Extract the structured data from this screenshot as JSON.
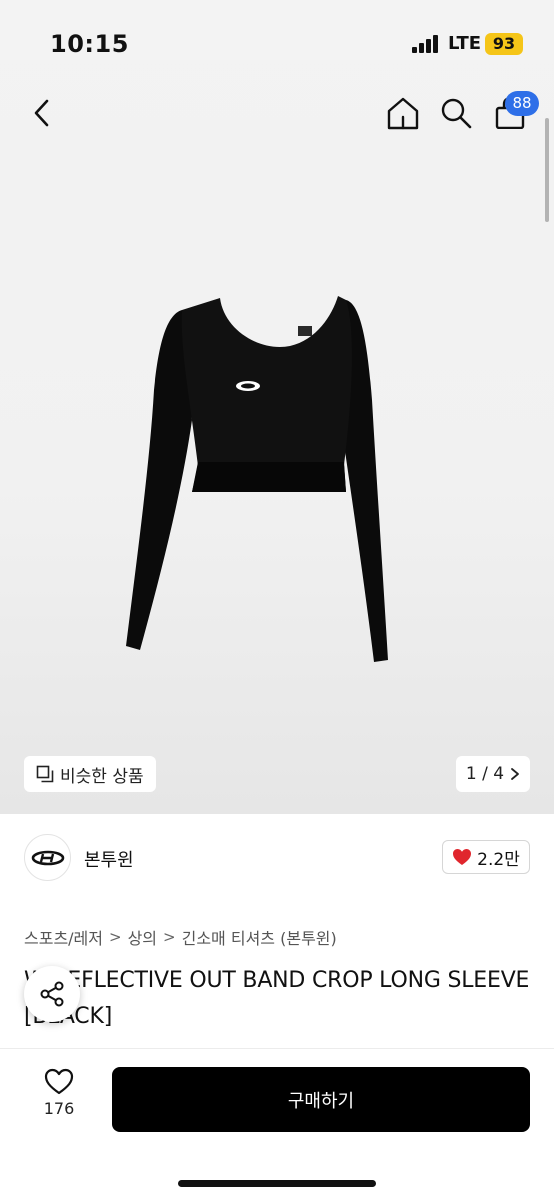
{
  "status_bar": {
    "time": "10:15",
    "network": "LTE",
    "battery": "93"
  },
  "nav": {
    "cart_count": "88"
  },
  "gallery": {
    "similar_label": "비슷한 상품",
    "page_indicator": "1 / 4"
  },
  "shop": {
    "name": "본투윈",
    "likes": "2.2만"
  },
  "breadcrumb": [
    "스포츠/레저",
    "상의",
    "긴소매 티셔츠 (본투윈)"
  ],
  "product": {
    "title": "W REFLECTIVE OUT BAND CROP LONG SLEEVE [BLACK]"
  },
  "bottom": {
    "wish_count": "176",
    "buy_label": "구매하기"
  },
  "colors": {
    "accent_blue": "#2e6fe8",
    "like_red": "#e0262d",
    "buy_button": "#000000",
    "battery": "#f5c518"
  },
  "icons": [
    "back-icon",
    "home-icon",
    "search-icon",
    "shopping-bag-icon",
    "copy-icon",
    "chevron-right-icon",
    "heart-icon",
    "share-icon"
  ]
}
